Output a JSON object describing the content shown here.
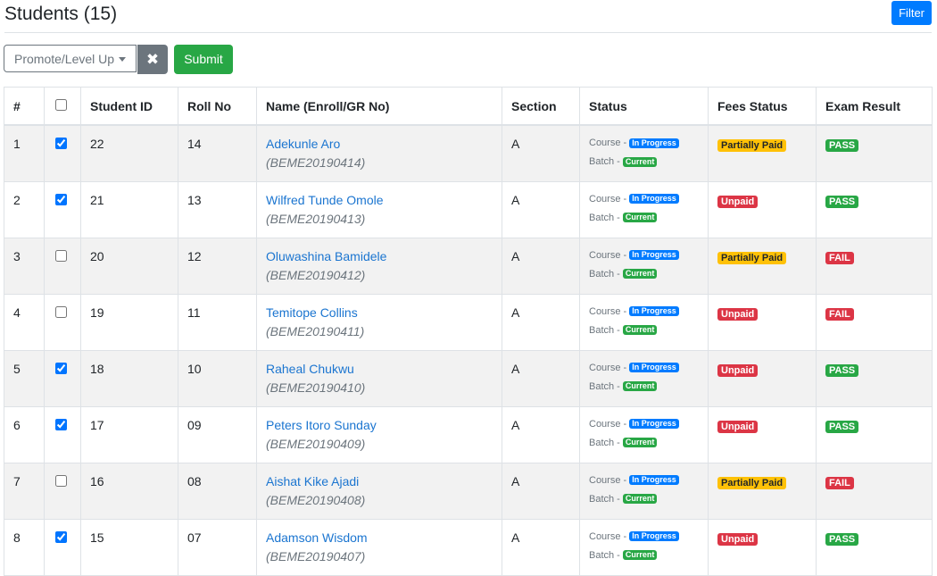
{
  "page": {
    "title": "Students (15)",
    "filter_label": "Filter"
  },
  "toolbar": {
    "action_select_value": "Promote/Level Up",
    "clear_icon": "✖",
    "submit_label": "Submit"
  },
  "table": {
    "columns": [
      "#",
      "",
      "Student ID",
      "Roll No",
      "Name (Enroll/GR No)",
      "Section",
      "Status",
      "Fees Status",
      "Exam Result"
    ],
    "status_labels": {
      "course": "Course -",
      "batch": "Batch -"
    },
    "rows": [
      {
        "num": "1",
        "checked": true,
        "student_id": "22",
        "roll": "14",
        "name": "Adekunle Aro",
        "enroll": "(BEME20190414)",
        "section": "A",
        "course_status": "In Progress",
        "batch_status": "Current",
        "fees": "Partially Paid",
        "fees_type": "partial",
        "result": "PASS",
        "result_type": "pass"
      },
      {
        "num": "2",
        "checked": true,
        "student_id": "21",
        "roll": "13",
        "name": "Wilfred Tunde Omole",
        "enroll": "(BEME20190413)",
        "section": "A",
        "course_status": "In Progress",
        "batch_status": "Current",
        "fees": "Unpaid",
        "fees_type": "unpaid",
        "result": "PASS",
        "result_type": "pass"
      },
      {
        "num": "3",
        "checked": false,
        "student_id": "20",
        "roll": "12",
        "name": "Oluwashina Bamidele",
        "enroll": "(BEME20190412)",
        "section": "A",
        "course_status": "In Progress",
        "batch_status": "Current",
        "fees": "Partially Paid",
        "fees_type": "partial",
        "result": "FAIL",
        "result_type": "fail"
      },
      {
        "num": "4",
        "checked": false,
        "student_id": "19",
        "roll": "11",
        "name": "Temitope Collins",
        "enroll": "(BEME20190411)",
        "section": "A",
        "course_status": "In Progress",
        "batch_status": "Current",
        "fees": "Unpaid",
        "fees_type": "unpaid",
        "result": "FAIL",
        "result_type": "fail"
      },
      {
        "num": "5",
        "checked": true,
        "student_id": "18",
        "roll": "10",
        "name": "Raheal Chukwu",
        "enroll": "(BEME20190410)",
        "section": "A",
        "course_status": "In Progress",
        "batch_status": "Current",
        "fees": "Unpaid",
        "fees_type": "unpaid",
        "result": "PASS",
        "result_type": "pass"
      },
      {
        "num": "6",
        "checked": true,
        "student_id": "17",
        "roll": "09",
        "name": "Peters Itoro Sunday",
        "enroll": "(BEME20190409)",
        "section": "A",
        "course_status": "In Progress",
        "batch_status": "Current",
        "fees": "Unpaid",
        "fees_type": "unpaid",
        "result": "PASS",
        "result_type": "pass"
      },
      {
        "num": "7",
        "checked": false,
        "student_id": "16",
        "roll": "08",
        "name": "Aishat Kike Ajadi",
        "enroll": "(BEME20190408)",
        "section": "A",
        "course_status": "In Progress",
        "batch_status": "Current",
        "fees": "Partially Paid",
        "fees_type": "partial",
        "result": "FAIL",
        "result_type": "fail"
      },
      {
        "num": "8",
        "checked": true,
        "student_id": "15",
        "roll": "07",
        "name": "Adamson Wisdom",
        "enroll": "(BEME20190407)",
        "section": "A",
        "course_status": "In Progress",
        "batch_status": "Current",
        "fees": "Unpaid",
        "fees_type": "unpaid",
        "result": "PASS",
        "result_type": "pass"
      }
    ]
  },
  "colors": {
    "primary": "#007bff",
    "success": "#28a745",
    "danger": "#dc3545",
    "warning": "#ffc107",
    "secondary": "#6c757d",
    "link": "#1b75d0"
  }
}
